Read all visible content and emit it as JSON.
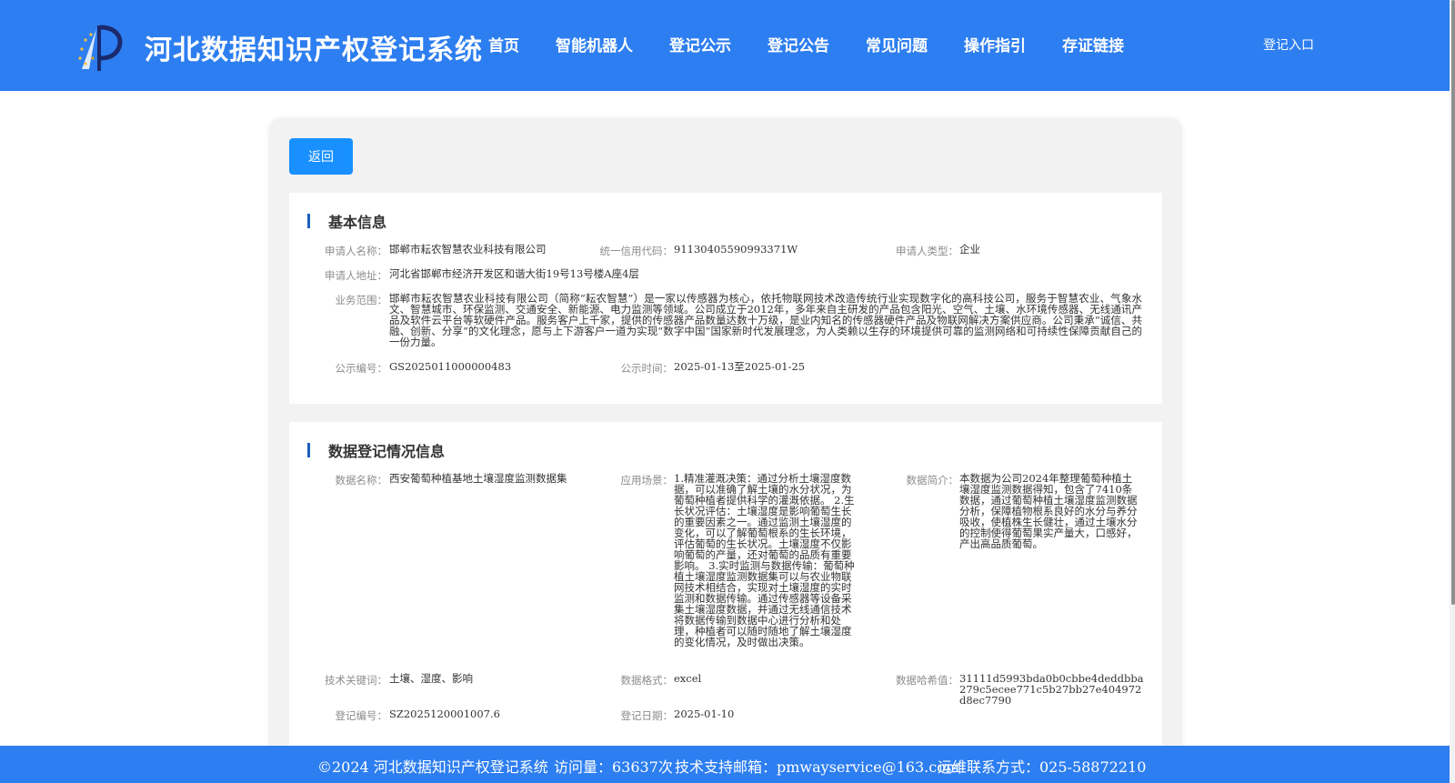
{
  "header": {
    "site_title": "河北数据知识产权登记系统",
    "nav": [
      "首页",
      "智能机器人",
      "登记公示",
      "登记公告",
      "常见问题",
      "操作指引",
      "存证链接"
    ],
    "login_label": "登记入口",
    "logo_icon": "scales-of-justice-logo-icon",
    "bg_color": "#2d7ef0"
  },
  "main": {
    "back_label": "返回",
    "basic_info": {
      "title": "基本信息",
      "applicant_name_label": "申请人名称：",
      "applicant_name": "邯郸市耘农智慧农业科技有限公司",
      "credit_code_label": "统一信用代码：",
      "credit_code": "91130405590993371W",
      "applicant_type_label": "申请人类型：",
      "applicant_type": "企业",
      "address_label": "申请人地址：",
      "address": "河北省邯郸市经济开发区和谐大街19号13号楼A座4层",
      "business_scope_label": "业务范围：",
      "business_scope": "邯郸市耘农智慧农业科技有限公司（简称“耘农智慧”）是一家以传感器为核心，依托物联网技术改造传统行业实现数字化的高科技公司，服务于智慧农业、气象水文、智慧城市、环保监测、交通安全、新能源、电力监测等领域。公司成立于2012年，多年来自主研发的产品包含阳光、空气、土壤、水环境传感器、无线通讯产品及软件云平台等软硬件产品。服务客户上千家，提供的传感器产品数量达数十万级，是业内知名的传感器硬件产品及物联网解决方案供应商。公司秉承“诚信、共融、创新、分享”的文化理念，愿与上下游客户一道为实现“数字中国”国家新时代发展理念，为人类赖以生存的环境提供可靠的监测网络和可持续性保障贡献自己的一份力量。",
      "notice_no_label": "公示编号：",
      "notice_no": "GS2025011000000483",
      "notice_time_label": "公示时间：",
      "notice_time": "2025-01-13至2025-01-25"
    },
    "data_info": {
      "title": "数据登记情况信息",
      "data_name_label": "数据名称：",
      "data_name": "西安葡萄种植基地土壤湿度监测数据集",
      "scenario_label": "应用场景：",
      "scenario": "1.精准灌溉决策：通过分析土壤湿度数据，可以准确了解土壤的水分状况，为葡萄种植者提供科学的灌溉依据。 2.生长状况评估：土壤湿度是影响葡萄生长的重要因素之一。通过监测土壤湿度的变化，可以了解葡萄根系的生长环境，评估葡萄的生长状况。土壤湿度不仅影响葡萄的产量，还对葡萄的品质有重要影响。 3.实时监测与数据传输：葡萄种植土壤湿度监测数据集可以与农业物联网技术相结合，实现对土壤湿度的实时监测和数据传输。通过传感器等设备采集土壤湿度数据，并通过无线通信技术将数据传输到数据中心进行分析和处理，种植者可以随时随地了解土壤湿度的变化情况，及时做出决策。",
      "summary_label": "数据简介：",
      "summary": "本数据为公司2024年整理葡萄种植土壤湿度监测数据得知，包含了7410条数据，通过葡萄种植土壤湿度监测数据分析，保障植物根系良好的水分与养分吸收，使植株生长健壮，通过土壤水分的控制使得葡萄果实产量大，口感好，产出高品质葡萄。",
      "keywords_label": "技术关键词：",
      "keywords": "土壤、湿度、影响",
      "format_label": "数据格式：",
      "format": "excel",
      "hash_label": "数据哈希值：",
      "hash": "31111d5993bda0b0cbbe4deddbba279c5ecee771c5b27bb27e404972d8ec7790",
      "reg_no_label": "登记编号：",
      "reg_no": "SZ2025120001007.6",
      "reg_date_label": "登记日期：",
      "reg_date": "2025-01-10"
    }
  },
  "footer": {
    "copyright": "©2024 河北数据知识产权登记系统",
    "visits": "访问量：63637次",
    "support": "技术支持邮箱：pmwayservice@163.com",
    "contact": "运维联系方式：025-58872210"
  }
}
